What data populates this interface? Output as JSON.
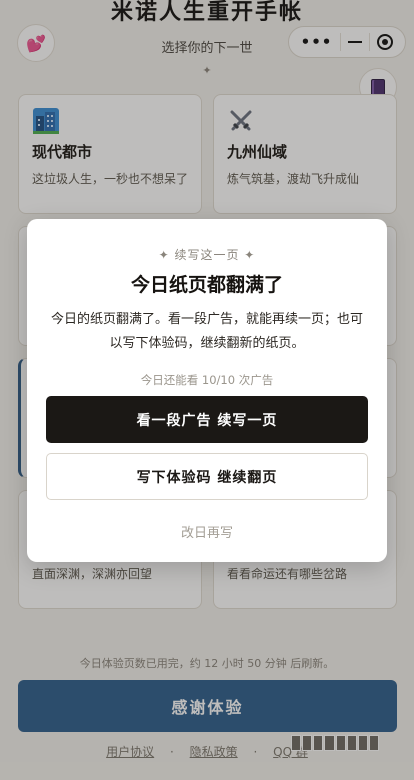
{
  "header": {
    "title": "米诺人生重开手帐",
    "subtitle": "选择你的下一世",
    "divider": "✦"
  },
  "capsule": {
    "more": "•••"
  },
  "cards": {
    "city": {
      "title": "现代都市",
      "desc": "这垃圾人生，一秒也不想呆了",
      "icon": "city-building-icon"
    },
    "xian": {
      "title": "九州仙域",
      "desc": "炼气筑基，渡劫飞升成仙",
      "icon": "crossed-swords-icon"
    },
    "abyss": {
      "desc": "直面深渊，深渊亦回望"
    },
    "fate": {
      "desc": "看看命运还有哪些岔路"
    }
  },
  "footer": {
    "note": "今日体验页数已用完，约 12 小时 50 分钟 后刷新。",
    "thanks_button": "感谢体验",
    "link_terms": "用户协议",
    "link_privacy": "隐私政策",
    "link_qq": "QQ 群",
    "dot": "·"
  },
  "modal": {
    "eyebrow": "✦ 续写这一页 ✦",
    "title": "今日纸页都翻满了",
    "body": "今日的纸页翻满了。看一段广告，就能再续一页；也可以写下体验码，继续翻新的纸页。",
    "quota": "今日还能看 10/10 次广告",
    "primary_button": "看一段广告 续写一页",
    "secondary_button": "写下体验码 继续翻页",
    "later": "改日再写"
  }
}
